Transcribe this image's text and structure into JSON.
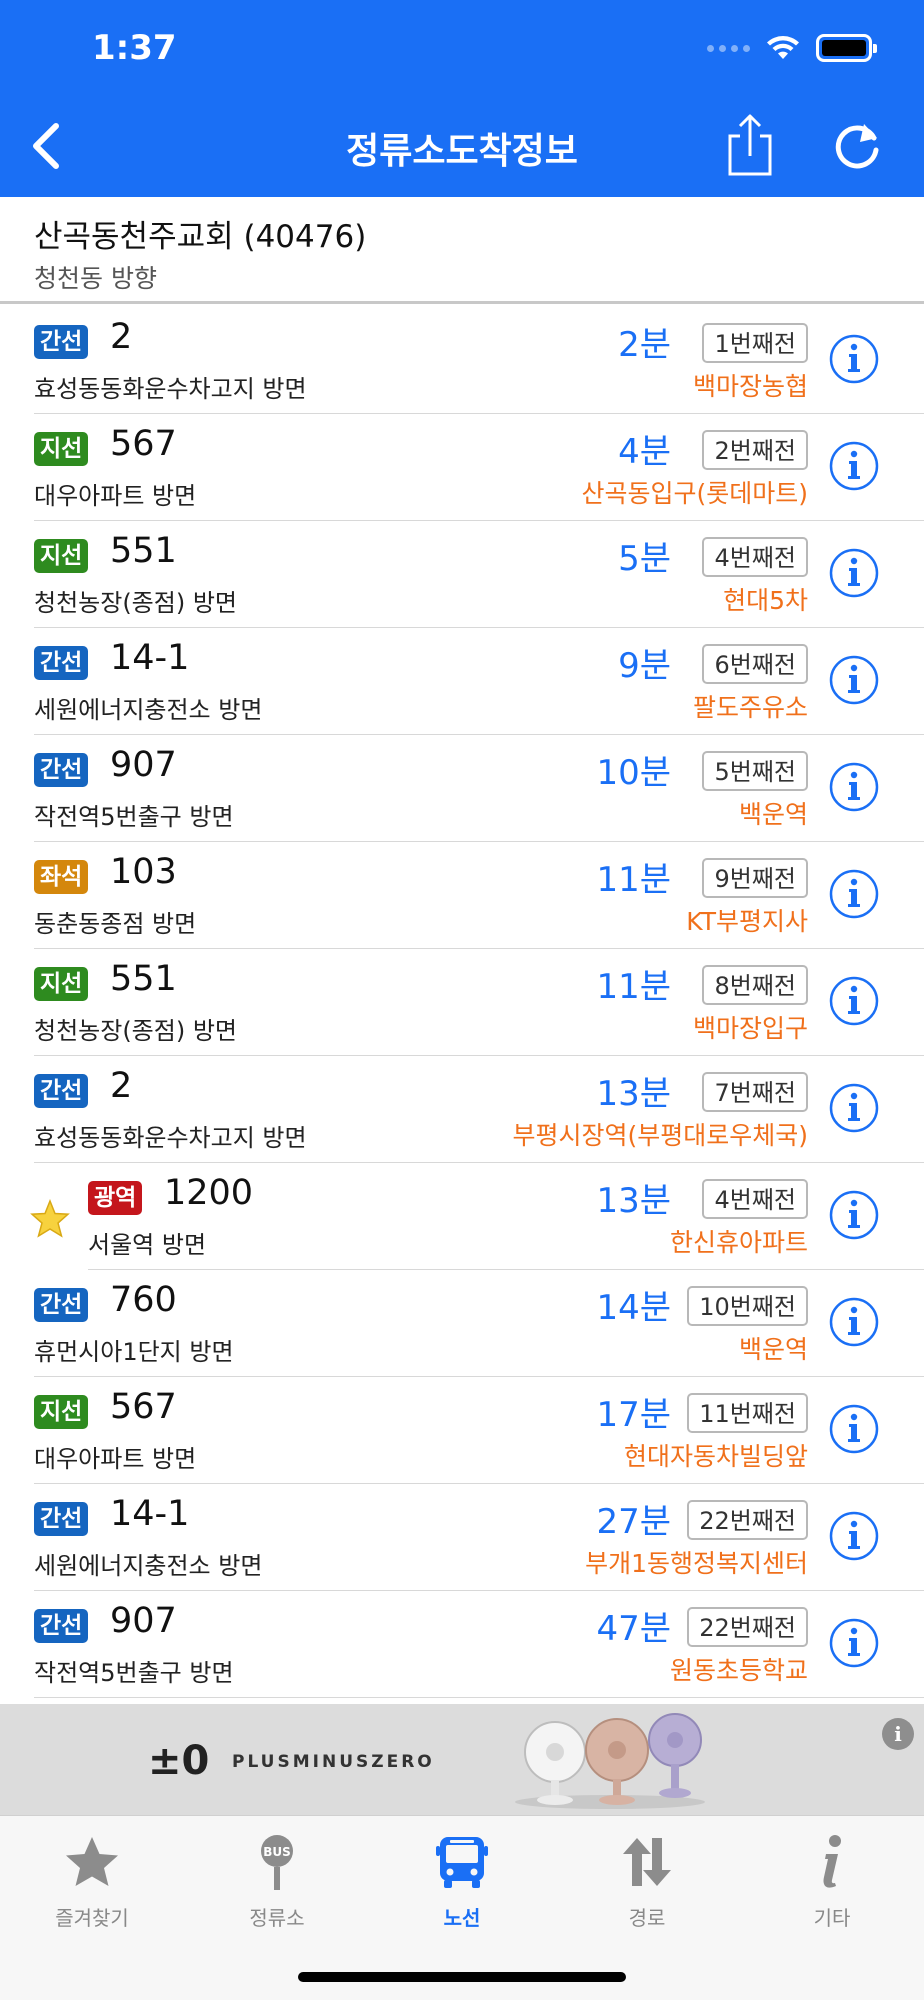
{
  "status_bar": {
    "time": "1:37"
  },
  "nav": {
    "title": "정류소도착정보",
    "back_icon": "chevron-left-icon",
    "share_icon": "share-icon",
    "refresh_icon": "refresh-icon"
  },
  "stop": {
    "name": "산곡동천주교회 (40476)",
    "direction": "청천동 방향"
  },
  "colors": {
    "accent": "#1a6ff5",
    "location": "#f0701b",
    "trunk": "#1565c0",
    "branch": "#2e8b1f",
    "seat": "#d4870c",
    "wide": "#c4161c"
  },
  "arrivals": [
    {
      "type": "간선",
      "type_color": "#1565c0",
      "route": "2",
      "direction": "효성동동화운수차고지 방면",
      "minutes": "2분",
      "stops_before": "1번째전",
      "location": "백마장농협",
      "favorite": false
    },
    {
      "type": "지선",
      "type_color": "#2e8b1f",
      "route": "567",
      "direction": "대우아파트 방면",
      "minutes": "4분",
      "stops_before": "2번째전",
      "location": "산곡동입구(롯데마트)",
      "favorite": false
    },
    {
      "type": "지선",
      "type_color": "#2e8b1f",
      "route": "551",
      "direction": "청천농장(종점) 방면",
      "minutes": "5분",
      "stops_before": "4번째전",
      "location": "현대5차",
      "favorite": false
    },
    {
      "type": "간선",
      "type_color": "#1565c0",
      "route": "14-1",
      "direction": "세원에너지충전소 방면",
      "minutes": "9분",
      "stops_before": "6번째전",
      "location": "팔도주유소",
      "favorite": false
    },
    {
      "type": "간선",
      "type_color": "#1565c0",
      "route": "907",
      "direction": "작전역5번출구 방면",
      "minutes": "10분",
      "stops_before": "5번째전",
      "location": "백운역",
      "favorite": false
    },
    {
      "type": "좌석",
      "type_color": "#d4870c",
      "route": "103",
      "direction": "동춘동종점 방면",
      "minutes": "11분",
      "stops_before": "9번째전",
      "location": "KT부평지사",
      "favorite": false
    },
    {
      "type": "지선",
      "type_color": "#2e8b1f",
      "route": "551",
      "direction": "청천농장(종점) 방면",
      "minutes": "11분",
      "stops_before": "8번째전",
      "location": "백마장입구",
      "favorite": false
    },
    {
      "type": "간선",
      "type_color": "#1565c0",
      "route": "2",
      "direction": "효성동동화운수차고지 방면",
      "minutes": "13분",
      "stops_before": "7번째전",
      "location": "부평시장역(부평대로우체국)",
      "favorite": false
    },
    {
      "type": "광역",
      "type_color": "#c4161c",
      "route": "1200",
      "direction": "서울역 방면",
      "minutes": "13분",
      "stops_before": "4번째전",
      "location": "한신휴아파트",
      "favorite": true
    },
    {
      "type": "간선",
      "type_color": "#1565c0",
      "route": "760",
      "direction": "휴먼시아1단지 방면",
      "minutes": "14분",
      "stops_before": "10번째전",
      "location": "백운역",
      "favorite": false
    },
    {
      "type": "지선",
      "type_color": "#2e8b1f",
      "route": "567",
      "direction": "대우아파트 방면",
      "minutes": "17분",
      "stops_before": "11번째전",
      "location": "현대자동차빌딩앞",
      "favorite": false
    },
    {
      "type": "간선",
      "type_color": "#1565c0",
      "route": "14-1",
      "direction": "세원에너지충전소 방면",
      "minutes": "27분",
      "stops_before": "22번째전",
      "location": "부개1동행정복지센터",
      "favorite": false
    },
    {
      "type": "간선",
      "type_color": "#1565c0",
      "route": "907",
      "direction": "작전역5번출구 방면",
      "minutes": "47분",
      "stops_before": "22번째전",
      "location": "원동초등학교",
      "favorite": false
    }
  ],
  "ad": {
    "logo": "±0",
    "brand": "PLUSMINUSZERO",
    "info": "i"
  },
  "tabs": [
    {
      "label": "즐겨찾기",
      "icon": "star-icon",
      "active": false
    },
    {
      "label": "정류소",
      "icon": "bus-stop-icon",
      "active": false
    },
    {
      "label": "노선",
      "icon": "bus-icon",
      "active": true
    },
    {
      "label": "경로",
      "icon": "route-arrows-icon",
      "active": false
    },
    {
      "label": "기타",
      "icon": "info-icon",
      "active": false
    }
  ]
}
